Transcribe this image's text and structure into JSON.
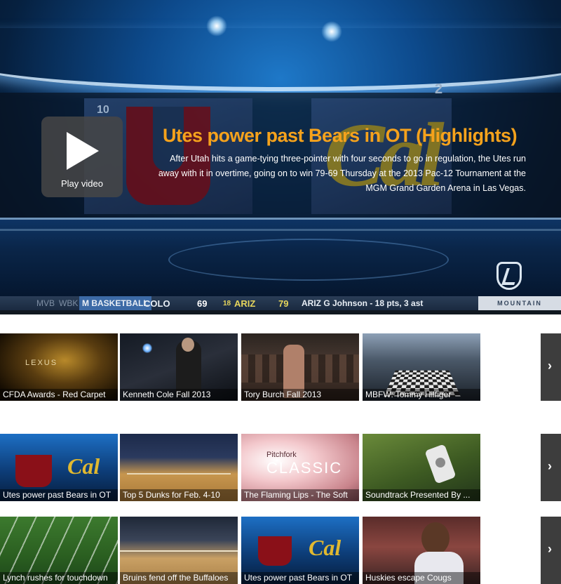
{
  "featured": {
    "play_label": "Play video",
    "title": "Utes power past Bears in OT (Highlights)",
    "description": "After Utah hits a game-tying three-pointer with four seconds to go in regulation, the Utes run away with it in overtime, going on to win 79-69 Thursday at the 2013 Pac-12 Tournament at the MGM Grand Garden Arena in Las Vegas.",
    "seed_left": "10",
    "seed_right": "2"
  },
  "ticker": {
    "items": [
      "MVB",
      "WBK"
    ],
    "league": "M BASKETBALL",
    "team1": "COLO",
    "score1": "69",
    "team2_seed": "18",
    "team2": "ARIZ",
    "score2": "79",
    "stat": "ARIZ G Johnson - 18 pts, 3 ast",
    "network": "MOUNTAIN"
  },
  "rows": [
    {
      "items": [
        {
          "caption": "CFDA Awards - Red Carpet",
          "scene": "gold",
          "brand": "LEXUS"
        },
        {
          "caption": "Kenneth Cole Fall 2013",
          "scene": "dark"
        },
        {
          "caption": "Tory Burch Fall 2013",
          "scene": "runway"
        },
        {
          "caption": "MBFW: Tommy Hilfiger",
          "scene": "hall"
        }
      ],
      "next_label": "›"
    },
    {
      "items": [
        {
          "caption": "Utes power past Bears in OT",
          "scene": "arena"
        },
        {
          "caption": "Top 5 Dunks for Feb. 4-10",
          "scene": "court"
        },
        {
          "caption": "The Flaming Lips - The Soft",
          "scene": "pink",
          "brand_top": "Pitchfork",
          "brand_main": "CLASSIC"
        },
        {
          "caption": "Soundtrack Presented By ...",
          "scene": "green"
        }
      ],
      "next_label": "›"
    },
    {
      "items": [
        {
          "caption": "Lynch rushes for touchdown",
          "scene": "field"
        },
        {
          "caption": "Bruins fend off the Buffaloes",
          "scene": "court2"
        },
        {
          "caption": "Utes power past Bears in OT",
          "scene": "arena"
        },
        {
          "caption": "Huskies escape Cougs",
          "scene": "crowd"
        }
      ],
      "next_label": "›"
    }
  ]
}
